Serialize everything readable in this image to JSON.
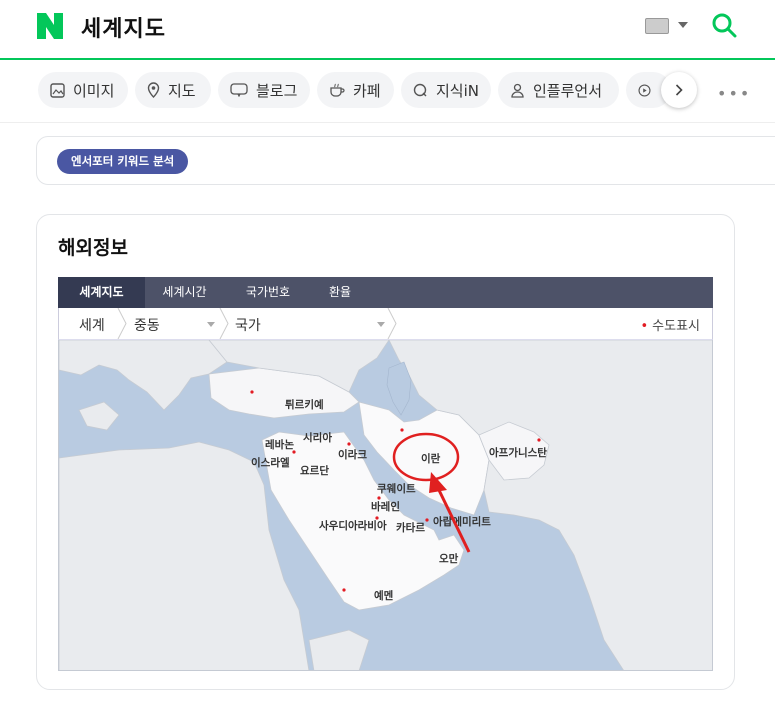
{
  "header": {
    "logo": "N",
    "title": "세계지도",
    "keyboard_icon": "keyboard-icon",
    "search_icon": "search-icon",
    "brand_color": "#03c75a"
  },
  "tabs": [
    {
      "label": "이미지",
      "icon": "image-icon"
    },
    {
      "label": "지도",
      "icon": "map-pin-icon"
    },
    {
      "label": "블로그",
      "icon": "blog-icon"
    },
    {
      "label": "카페",
      "icon": "cafe-icon"
    },
    {
      "label": "지식iN",
      "icon": "kin-icon"
    },
    {
      "label": "인플루언서",
      "icon": "person-icon"
    }
  ],
  "keyword": {
    "label": "엔서포터 키워드 분석",
    "color": "#4a57a3"
  },
  "card": {
    "title": "해외정보",
    "map_tabs": [
      "세계지도",
      "세계시간",
      "국가번호",
      "환율"
    ],
    "breadcrumb": {
      "root": "세계",
      "region": "중동",
      "country": "국가"
    },
    "capital_toggle": "수도표시",
    "countries": [
      "튀르키예",
      "시리아",
      "레바논",
      "이스라엘",
      "이라크",
      "요르단",
      "이란",
      "아프가니스탄",
      "쿠웨이트",
      "바레인",
      "카타르",
      "아랍에미리트",
      "사우디아라비아",
      "오만",
      "예멘"
    ]
  }
}
